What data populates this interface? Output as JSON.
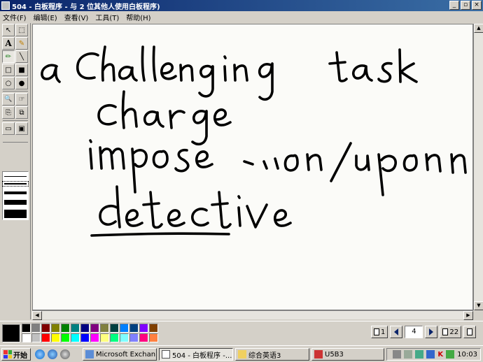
{
  "window": {
    "title": "504 - 白板程序 - 与 2 位其他人使用白板程序)",
    "minimize_glyph": "_",
    "maximize_glyph": "▫",
    "close_glyph": "×"
  },
  "menu": [
    "文件(F)",
    "编辑(E)",
    "查看(V)",
    "工具(T)",
    "帮助(H)"
  ],
  "toolbox": {
    "tools": [
      {
        "name": "select-arrow-tool",
        "glyph": "↖"
      },
      {
        "name": "area-select-tool",
        "glyph": "⬚"
      },
      {
        "name": "text-tool",
        "glyph": "A"
      },
      {
        "name": "highlighter-tool",
        "glyph": "✎"
      },
      {
        "name": "pen-tool",
        "glyph": "✏"
      },
      {
        "name": "line-tool",
        "glyph": "╲"
      },
      {
        "name": "rectangle-tool",
        "glyph": "□"
      },
      {
        "name": "filled-rectangle-tool",
        "glyph": "■"
      },
      {
        "name": "ellipse-tool",
        "glyph": "○"
      },
      {
        "name": "filled-ellipse-tool",
        "glyph": "●"
      },
      {
        "name": "zoom-tool",
        "glyph": "🔍"
      },
      {
        "name": "remote-pointer-tool",
        "glyph": "☞"
      },
      {
        "name": "lock-contents-tool",
        "glyph": "⎘"
      },
      {
        "name": "synchronize-tool",
        "glyph": "⧉"
      },
      {
        "name": "select-window-tool",
        "glyph": "▭"
      },
      {
        "name": "select-area-tool",
        "glyph": "▣"
      }
    ],
    "selected_tool": "pen-tool"
  },
  "canvas": {
    "handwriting_lines": [
      "a Challenging   task",
      "charge",
      "impose …… on/upon",
      "detective"
    ],
    "ink_color": "#000000"
  },
  "palette": {
    "current_color": "#000000",
    "colors": [
      "#000000",
      "#808080",
      "#800000",
      "#808000",
      "#008000",
      "#008080",
      "#000080",
      "#800080",
      "#808040",
      "#004040",
      "#0080ff",
      "#004080",
      "#8000ff",
      "#804000",
      "#ffffff",
      "#c0c0c0",
      "#ff0000",
      "#ffff00",
      "#00ff00",
      "#00ffff",
      "#0000ff",
      "#ff00ff",
      "#ffff80",
      "#00ff80",
      "#80ffff",
      "#8080ff",
      "#ff0080",
      "#ff8040"
    ]
  },
  "pager": {
    "first_page": "1",
    "current_page": "4",
    "last_page": "22"
  },
  "taskbar": {
    "start_label": "开始",
    "tasks": [
      {
        "label": "Microsoft Exchan...",
        "active": false
      },
      {
        "label": "504 - 白板程序 -...",
        "active": true
      },
      {
        "label": "综合英语3",
        "active": false
      },
      {
        "label": "U5B3",
        "active": false
      }
    ],
    "clock": "10:03"
  }
}
